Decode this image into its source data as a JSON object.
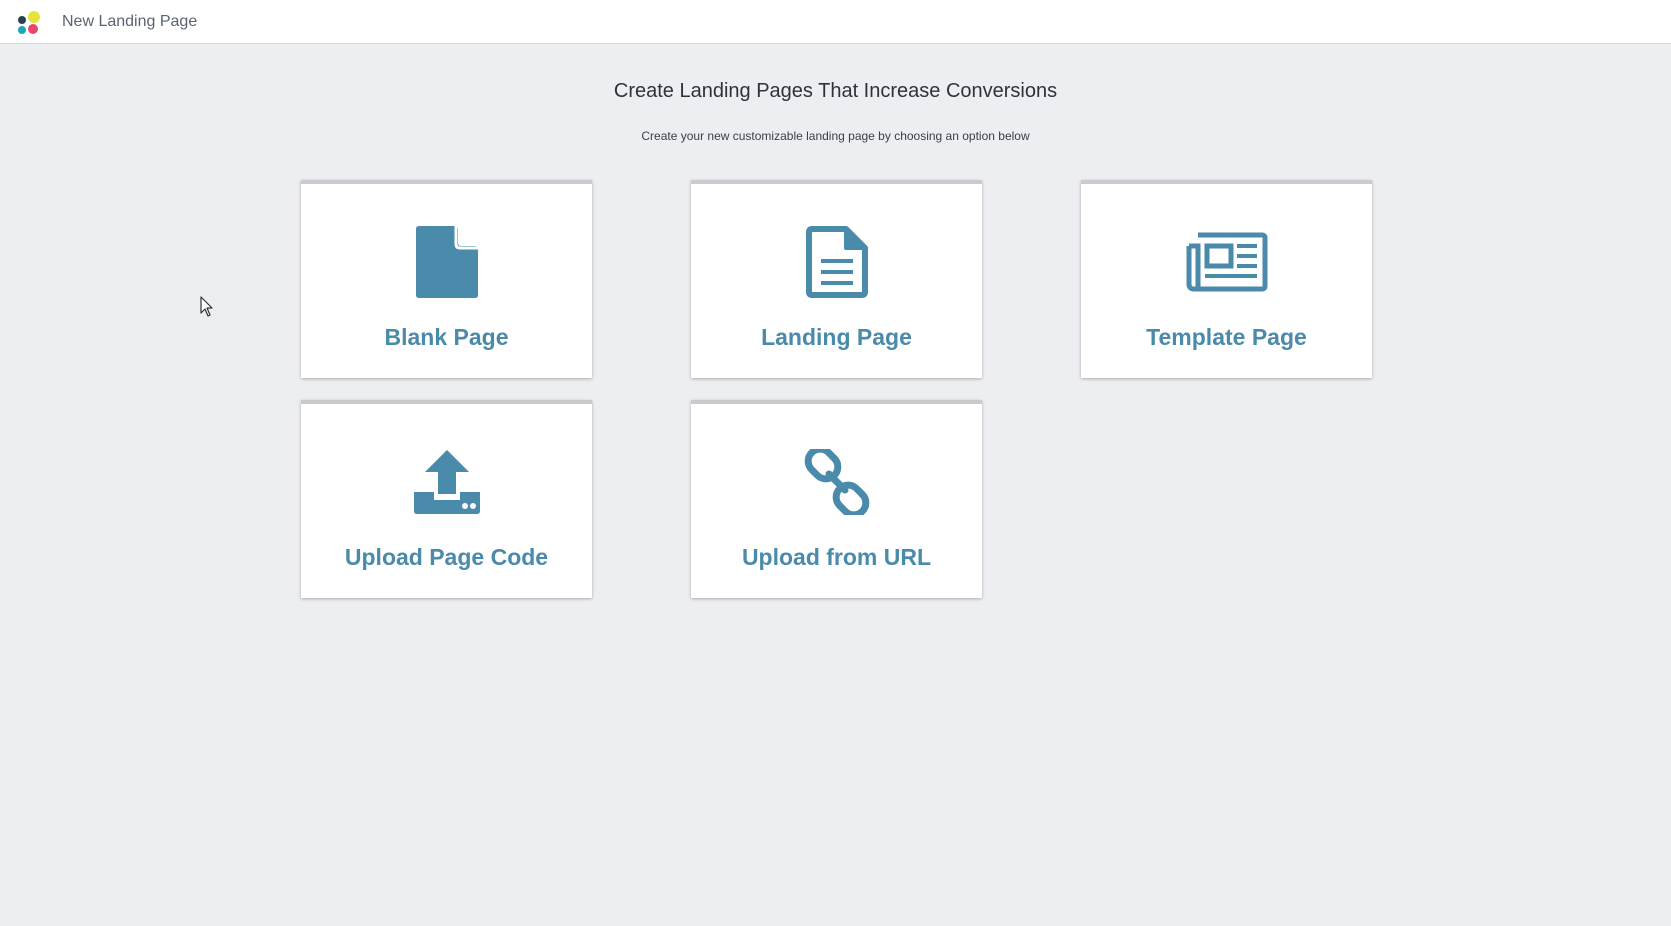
{
  "app": {
    "title": "New Landing Page",
    "logo_icon": "app-logo-icon"
  },
  "main": {
    "heading": "Create Landing Pages That Increase Conversions",
    "subheading": "Create your new customizable landing page by choosing an option below"
  },
  "options": [
    {
      "label": "Blank Page",
      "icon": "blank-page-icon"
    },
    {
      "label": "Landing Page",
      "icon": "document-lines-icon"
    },
    {
      "label": "Template Page",
      "icon": "newspaper-icon"
    },
    {
      "label": "Upload Page Code",
      "icon": "upload-icon"
    },
    {
      "label": "Upload from URL",
      "icon": "link-chain-icon"
    }
  ],
  "colors": {
    "accent": "#4a8aaa",
    "background": "#edeef1",
    "card": "#ffffff"
  }
}
